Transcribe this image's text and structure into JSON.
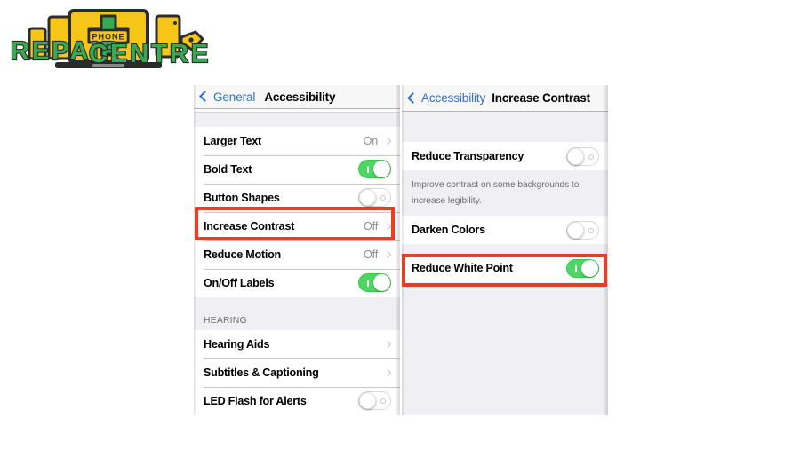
{
  "logo": {
    "text_top": "REPAIR",
    "text_bottom": "CENTRE",
    "badge_text": "PHONE",
    "colors": {
      "green": "#3aa853",
      "yellow": "#f5c518",
      "outline": "#2b2b2b"
    }
  },
  "left_panel": {
    "navbar": {
      "back_label": "General",
      "back_icon": "chevron-left-icon",
      "title": "Accessibility"
    },
    "rows": [
      {
        "label": "Larger Text",
        "value": "On",
        "accessory": "chevron",
        "toggle": null
      },
      {
        "label": "Bold Text",
        "value": "",
        "accessory": "toggle",
        "toggle": "on"
      },
      {
        "label": "Button Shapes",
        "value": "",
        "accessory": "toggle",
        "toggle": "off"
      },
      {
        "label": "Increase Contrast",
        "value": "Off",
        "accessory": "chevron",
        "toggle": null
      },
      {
        "label": "Reduce Motion",
        "value": "Off",
        "accessory": "chevron",
        "toggle": null
      },
      {
        "label": "On/Off Labels",
        "value": "",
        "accessory": "toggle",
        "toggle": "on"
      }
    ],
    "section_header": "HEARING",
    "rows2": [
      {
        "label": "Hearing Aids",
        "value": "",
        "accessory": "chevron",
        "toggle": null
      },
      {
        "label": "Subtitles & Captioning",
        "value": "",
        "accessory": "chevron",
        "toggle": null
      },
      {
        "label": "LED Flash for Alerts",
        "value": "",
        "accessory": "toggle",
        "toggle": "off"
      }
    ]
  },
  "right_panel": {
    "navbar": {
      "back_label": "Accessibility",
      "back_icon": "chevron-left-icon",
      "title": "Increase Contrast"
    },
    "rows": [
      {
        "label": "Reduce Transparency",
        "value": "",
        "accessory": "toggle",
        "toggle": "off"
      }
    ],
    "footnote": "Improve contrast on some backgrounds to increase legibility.",
    "rows2": [
      {
        "label": "Darken Colors",
        "value": "",
        "accessory": "toggle",
        "toggle": "off"
      }
    ],
    "rows3": [
      {
        "label": "Reduce White Point",
        "value": "",
        "accessory": "toggle",
        "toggle": "on"
      }
    ]
  },
  "highlights": {
    "color": "#ee3b22",
    "left_target": "Increase Contrast",
    "right_target": "Reduce White Point"
  }
}
